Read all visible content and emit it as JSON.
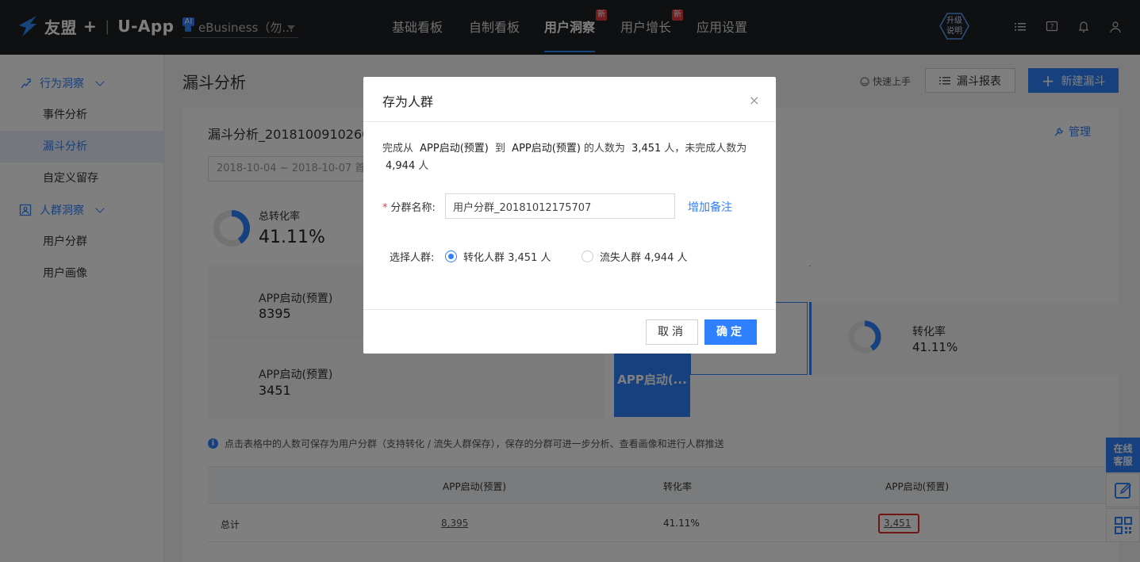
{
  "topnav": {
    "brand": "友盟",
    "brand_plus": "+",
    "product": "U-App",
    "ai_badge": "AI",
    "app_name": "eBusiness（勿...",
    "items": [
      {
        "label": "基础看板"
      },
      {
        "label": "自制看板"
      },
      {
        "label": "用户洞察",
        "badge": "新"
      },
      {
        "label": "用户增长",
        "badge": "新"
      },
      {
        "label": "应用设置"
      }
    ],
    "upgrade_line1": "升级",
    "upgrade_line2": "说明"
  },
  "sidebar": {
    "group1": "行为洞察",
    "items1": [
      "事件分析",
      "漏斗分析",
      "自定义留存"
    ],
    "group2": "人群洞察",
    "items2": [
      "用户分群",
      "用户画像"
    ]
  },
  "page": {
    "title": "漏斗分析",
    "quick_start": "快速上手",
    "report_btn": "漏斗报表",
    "new_btn": "新建漏斗",
    "funnel_name": "漏斗分析_20181009102604",
    "manage": "管理",
    "date_range": "2018-10-04 ~ 2018-10-07  首",
    "total_label": "总转化率",
    "total_value": "41.11%",
    "step1_name": "APP启动(预置)",
    "step1_count": "8395",
    "step2_name": "APP启动(预置)",
    "step2_count": "3451",
    "bar_label": "APP启动(...",
    "conv_label": "转化率",
    "conv_value": "41.11%",
    "hint": "点击表格中的人数可保存为用户分群（支持转化 / 流失人群保存），保存的分群可进一步分析、查看画像和进行人群推送"
  },
  "table": {
    "headers": [
      "APP启动(预置)",
      "转化率",
      "APP启动(预置)"
    ],
    "row": {
      "label": "总计",
      "col1": "8,395",
      "col2": "41.11%",
      "col3": "3,451"
    }
  },
  "modal": {
    "title": "存为人群",
    "close": "×",
    "desc_prefix": "完成从",
    "desc_from": "APP启动(预置)",
    "desc_to_word": "到",
    "desc_to": "APP启动(预置)",
    "desc_mid": "的人数为",
    "done_count": "3,451",
    "desc_mid2": "人，未完成人数为",
    "undone_count": "4,944",
    "desc_suffix": "人",
    "name_label": "分群名称:",
    "name_value": "用户分群_20181012175707",
    "add_note": "增加备注",
    "select_label": "选择人群:",
    "option1": "转化人群 3,451 人",
    "option2": "流失人群 4,944 人",
    "selected": "option1",
    "cancel": "取消",
    "ok": "确定"
  },
  "float": {
    "cs_line1": "在线",
    "cs_line2": "客服"
  },
  "colors": {
    "accent": "#2f80ff",
    "highlight": "#e52a2a",
    "nav_bg": "#1f2023"
  }
}
